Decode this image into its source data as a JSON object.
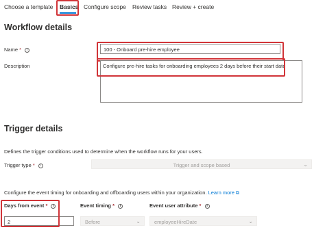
{
  "tabs": [
    {
      "label": "Choose a template"
    },
    {
      "label": "Basics"
    },
    {
      "label": "Configure scope"
    },
    {
      "label": "Review tasks"
    },
    {
      "label": "Review + create"
    }
  ],
  "workflow_details": {
    "title": "Workflow details",
    "name_label": "Name",
    "name_required": "*",
    "name_value": "100 - Onboard pre-hire employee",
    "description_label": "Description",
    "description_value": "Configure pre-hire tasks for onboarding employees 2 days before their start date"
  },
  "trigger_details": {
    "title": "Trigger details",
    "intro": "Defines the trigger conditions used to determine when the workflow runs for your users.",
    "trigger_type_label": "Trigger type",
    "trigger_type_required": "*",
    "trigger_type_value": "Trigger and scope based",
    "timing_intro": "Configure the event timing for onboarding and offboarding users within your organization.",
    "learn_more": "Learn more",
    "days_label": "Days from event",
    "days_required": "*",
    "days_value": "2",
    "event_timing_label": "Event timing",
    "event_timing_required": "*",
    "event_timing_value": "Before",
    "event_attr_label": "Event user attribute",
    "event_attr_required": "*",
    "event_attr_value": "employeeHireDate"
  },
  "icons": {
    "info": "info-icon",
    "chevron": "chevron-down-icon",
    "external": "external-link-icon"
  },
  "colors": {
    "accent": "#0078d4",
    "highlight": "#d13438",
    "required": "#a4262c"
  }
}
